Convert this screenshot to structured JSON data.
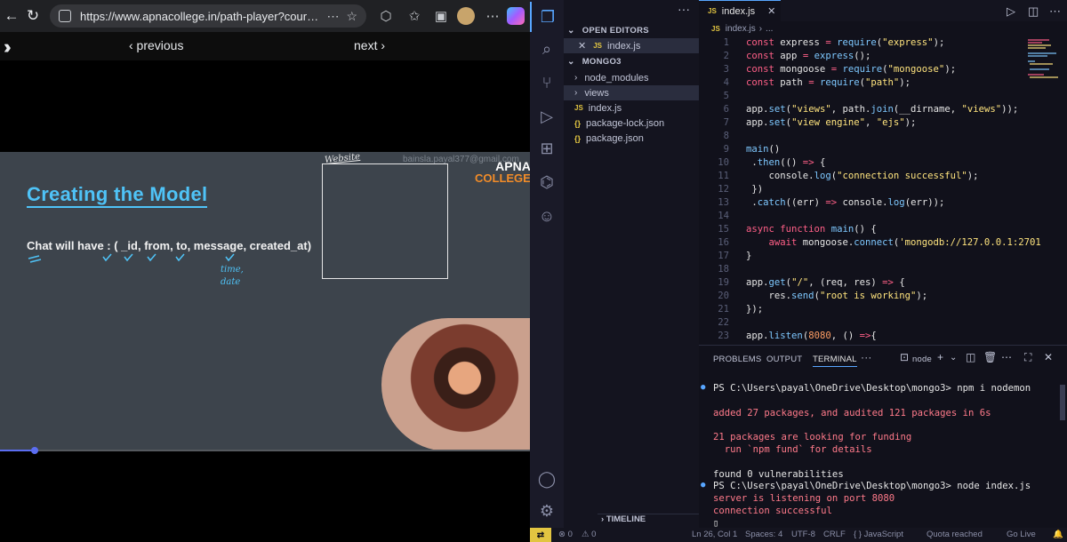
{
  "browser": {
    "url": "https://www.apnacollege.in/path-player?courseid=sig...",
    "nav": {
      "previous": "‹ previous",
      "next": "next ›"
    },
    "slide": {
      "title": "Creating the Model",
      "text": "Chat will have : ( _id, from, to, message, created_at)",
      "email": "bainsla.payal377@gmail.com",
      "logo_line1": "APNA",
      "logo_line2": "COLLEGE",
      "website_label": "Website",
      "time_label": "time,",
      "date_label": "date"
    },
    "progress": 0.065
  },
  "vscode": {
    "sidebar": {
      "dots": "···",
      "open_editors_label": "OPEN EDITORS",
      "open_editor_file": "index.js",
      "project_label": "MONGO3",
      "items": [
        {
          "label": "node_modules",
          "kind": "folder"
        },
        {
          "label": "views",
          "kind": "folder"
        },
        {
          "label": "index.js",
          "kind": "js"
        },
        {
          "label": "package-lock.json",
          "kind": "json"
        },
        {
          "label": "package.json",
          "kind": "json"
        }
      ],
      "timeline_label": "TIMELINE"
    },
    "editor": {
      "tab_label": "index.js",
      "breadcrumb_file": "index.js",
      "breadcrumb_more": "...",
      "code_lines": [
        "const express = require(\"express\");",
        "const app = express();",
        "const mongoose = require(\"mongoose\");",
        "const path = require(\"path\");",
        "",
        "app.set(\"views\", path.join(__dirname, \"views\"));",
        "app.set(\"view engine\", \"ejs\");",
        "",
        "main()",
        " .then(() => {",
        "    console.log(\"connection successful\");",
        " })",
        " .catch((err) => console.log(err));",
        "",
        "async function main() {",
        "    await mongoose.connect('mongodb://127.0.0.1:2701",
        "}",
        "",
        "app.get(\"/\", (req, res) => {",
        "    res.send(\"root is working\");",
        "});",
        "",
        "app.listen(8080, () =>{"
      ],
      "line_numbers": [
        "1",
        "2",
        "3",
        "4",
        "5",
        "6",
        "7",
        "8",
        "9",
        "10",
        "11",
        "12",
        "13",
        "14",
        "15",
        "16",
        "17",
        "18",
        "19",
        "20",
        "21",
        "22",
        "23"
      ]
    },
    "panel": {
      "tabs": [
        "PROBLEMS",
        "OUTPUT",
        "TERMINAL"
      ],
      "active_tab": "TERMINAL",
      "more": "···",
      "terminal_name": "node",
      "lines": [
        {
          "text": "PS C:\\Users\\payal\\OneDrive\\Desktop\\mongo3> npm i nodemon",
          "style": "prompt",
          "dot": true
        },
        {
          "text": "",
          "style": "plain"
        },
        {
          "text": "added 27 packages, and audited 121 packages in 6s",
          "style": "out"
        },
        {
          "text": "",
          "style": "plain"
        },
        {
          "text": "21 packages are looking for funding",
          "style": "out"
        },
        {
          "text": "  run `npm fund` for details",
          "style": "out"
        },
        {
          "text": "",
          "style": "plain"
        },
        {
          "text": "found 0 vulnerabilities",
          "style": "plain"
        },
        {
          "text": "PS C:\\Users\\payal\\OneDrive\\Desktop\\mongo3> node index.js",
          "style": "prompt",
          "dot": true
        },
        {
          "text": "server is listening on port 8080",
          "style": "out"
        },
        {
          "text": "connection successful",
          "style": "out"
        },
        {
          "text": "▯",
          "style": "plain"
        }
      ]
    },
    "status_bar": {
      "errors": "⊗ 0",
      "warnings": "⚠ 0",
      "position": "Ln 26, Col 1",
      "spaces": "Spaces: 4",
      "encoding": "UTF-8",
      "eol": "CRLF",
      "language": "{ } JavaScript",
      "quota": "Quota reached",
      "golive": "Go Live"
    },
    "colors": {
      "accent": "#58a6ff",
      "keyword": "#ff5f87",
      "string": "#ffe47e",
      "terminal_output": "#ff7a8a"
    }
  }
}
